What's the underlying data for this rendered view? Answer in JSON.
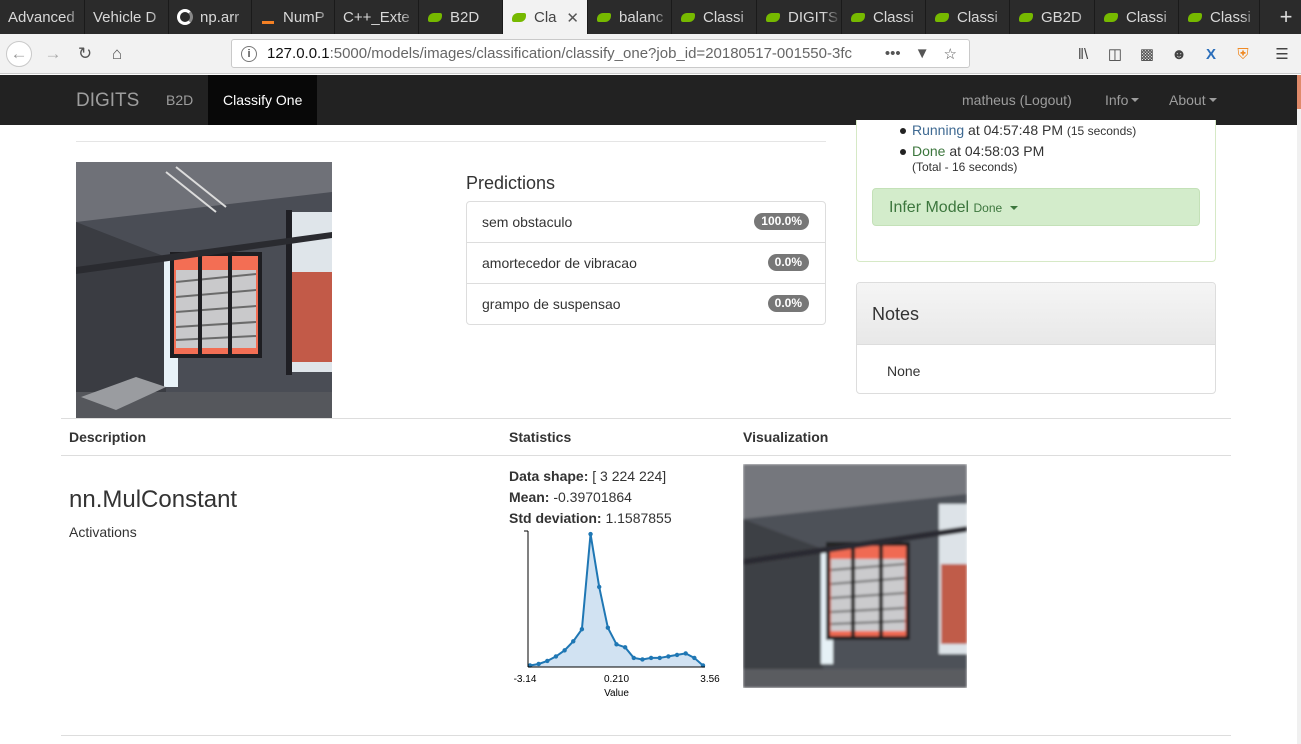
{
  "browser": {
    "tabs": [
      {
        "label": "Advanced",
        "icon": "none"
      },
      {
        "label": "Vehicle D",
        "icon": "none"
      },
      {
        "label": "np.arr",
        "icon": "google"
      },
      {
        "label": "NumP",
        "icon": "stackoverflow"
      },
      {
        "label": "C++_Exte",
        "icon": "none"
      },
      {
        "label": "B2D",
        "icon": "nvidia"
      },
      {
        "label": "Cla",
        "icon": "nvidia",
        "active": true
      },
      {
        "label": "balanc",
        "icon": "nvidia"
      },
      {
        "label": "Classi",
        "icon": "nvidia"
      },
      {
        "label": "DIGITS",
        "icon": "nvidia"
      },
      {
        "label": "Classi",
        "icon": "nvidia"
      },
      {
        "label": "Classi",
        "icon": "nvidia"
      },
      {
        "label": "GB2D",
        "icon": "nvidia"
      },
      {
        "label": "Classi",
        "icon": "nvidia"
      },
      {
        "label": "Classi",
        "icon": "nvidia"
      }
    ],
    "url_host": "127.0.0.1",
    "url_rest": ":5000/models/images/classification/classify_one?job_id=20180517-001550-3fc",
    "new_tab": "+",
    "more_dots": "•••"
  },
  "appnav": {
    "brand": "DIGITS",
    "b2d": "B2D",
    "classify_one": "Classify One",
    "user": "matheus (Logout)",
    "info": "Info",
    "about": "About"
  },
  "job_status": {
    "running_label": "Running",
    "running_at": " at 04:57:48 PM ",
    "running_dur": "(15 seconds)",
    "done_label": "Done",
    "done_at": " at 04:58:03 PM",
    "total": "(Total - 16 seconds)",
    "infer_label": "Infer Model",
    "infer_status": "Done"
  },
  "predictions": {
    "title": "Predictions",
    "items": [
      {
        "label": "sem obstaculo",
        "value": "100.0%"
      },
      {
        "label": "amortecedor de vibracao",
        "value": "0.0%"
      },
      {
        "label": "grampo de suspensao",
        "value": "0.0%"
      }
    ]
  },
  "notes": {
    "title": "Notes",
    "body": "None"
  },
  "layers": {
    "headers": {
      "description": "Description",
      "statistics": "Statistics",
      "visualization": "Visualization"
    },
    "layer_name": "nn.MulConstant",
    "layer_type": "Activations",
    "shape_label": "Data shape:",
    "shape_value": " [ 3 224 224]",
    "mean_label": "Mean:",
    "mean_value": " -0.39701864",
    "std_label": "Std deviation:",
    "std_value": " 1.1587855"
  },
  "chart_data": {
    "type": "area",
    "xlabel": "Value",
    "x_ticks": [
      "-3.14",
      "0.210",
      "3.56"
    ],
    "xlim": [
      -3.14,
      3.56
    ],
    "values": [
      0.01,
      0.02,
      0.04,
      0.07,
      0.11,
      0.17,
      0.25,
      0.88,
      0.53,
      0.26,
      0.15,
      0.13,
      0.06,
      0.05,
      0.06,
      0.06,
      0.07,
      0.08,
      0.09,
      0.06,
      0.01
    ],
    "colors": {
      "line": "#1f77b4",
      "fill": "#c6dbef"
    }
  }
}
